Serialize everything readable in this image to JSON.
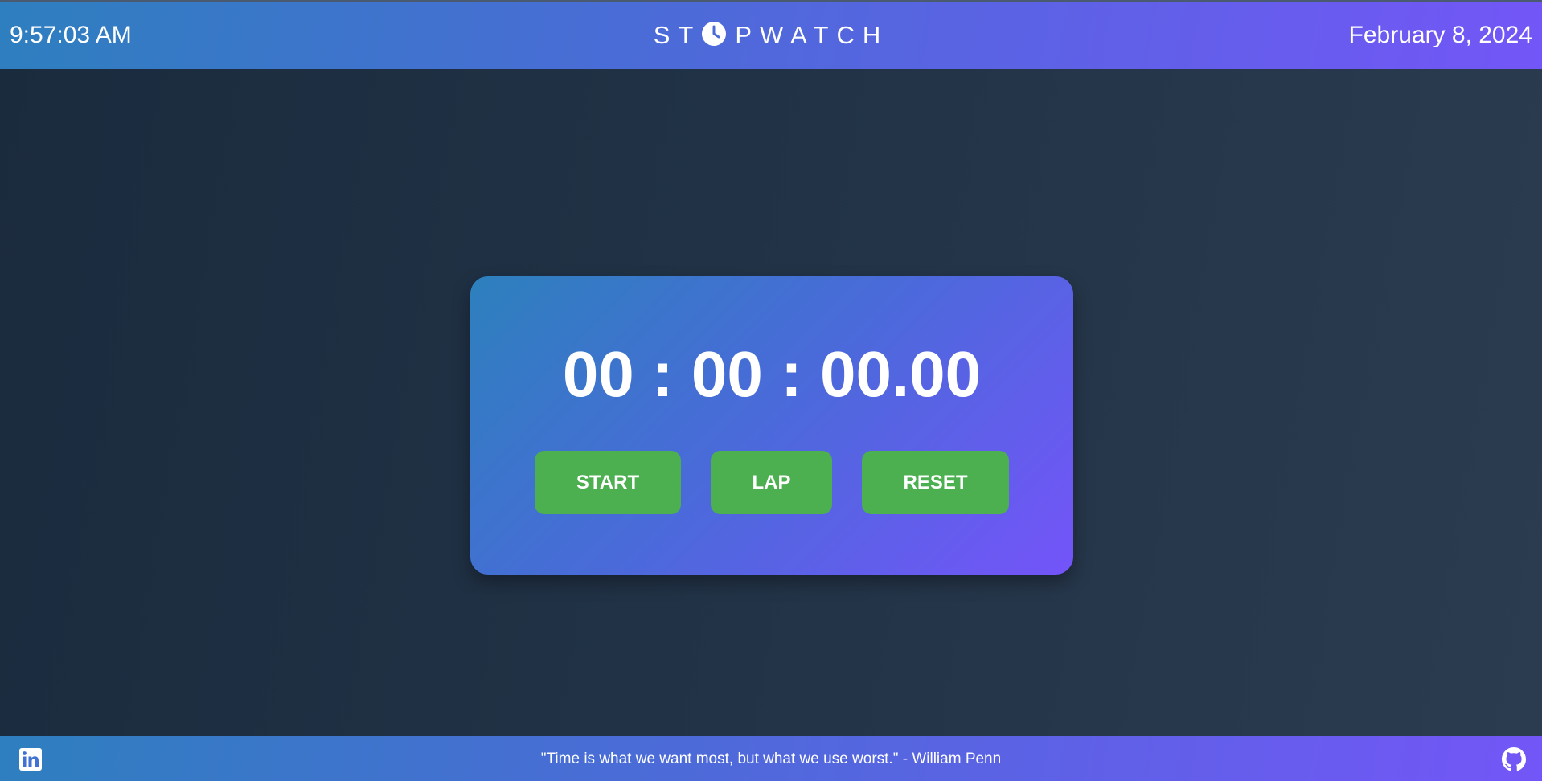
{
  "header": {
    "time": "9:57:03 AM",
    "title_before_icon": "ST",
    "title_icon": "clock-icon",
    "title_after_icon": "PWATCH",
    "date": "February 8, 2024"
  },
  "stopwatch": {
    "display": "00 : 00 : 00.00",
    "buttons": {
      "start": "START",
      "lap": "LAP",
      "reset": "RESET"
    }
  },
  "footer": {
    "quote": "\"Time is what we want most, but what we use worst.\" - William Penn",
    "left_icon": "linkedin-icon",
    "right_icon": "github-icon"
  },
  "colors": {
    "gradient_start": "#2e7fbf",
    "gradient_end": "#7356f7",
    "background": "#1b2b3e",
    "button": "#4caf50",
    "text": "#ffffff"
  }
}
